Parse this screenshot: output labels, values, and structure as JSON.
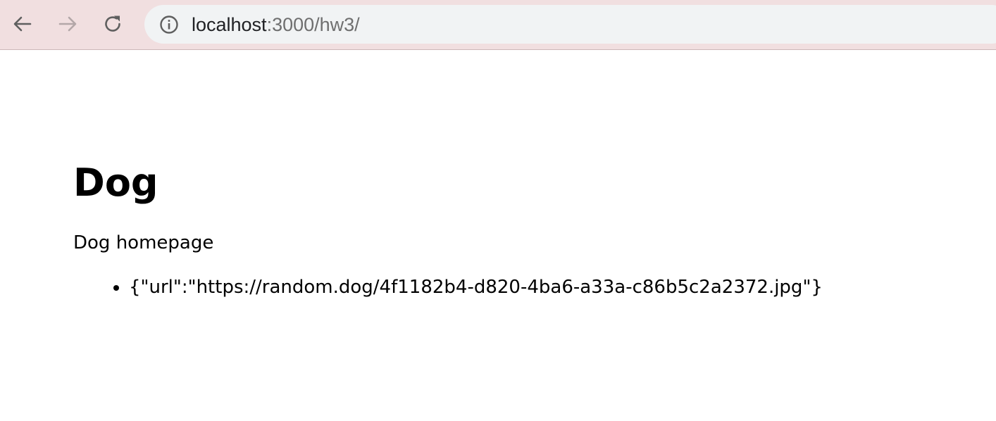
{
  "browser": {
    "url_host": "localhost",
    "url_path": ":3000/hw3/",
    "icons": {
      "back": "arrow-left-icon",
      "forward": "arrow-right-icon",
      "reload": "reload-icon",
      "info": "info-circle-icon"
    },
    "colors": {
      "toolbar_bg": "#f1dfe0",
      "omnibox_bg": "#f1f3f4"
    }
  },
  "page": {
    "heading": "Dog",
    "subtitle": "Dog homepage",
    "items": [
      "{\"url\":\"https://random.dog/4f1182b4-d820-4ba6-a33a-c86b5c2a2372.jpg\"}"
    ]
  }
}
